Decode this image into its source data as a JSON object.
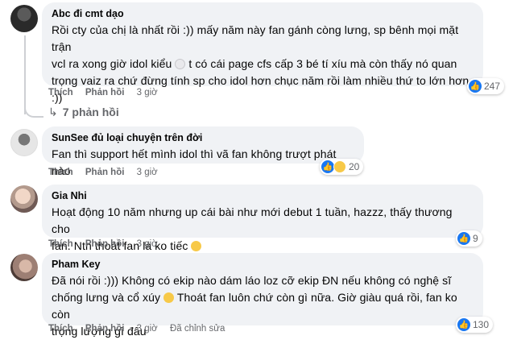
{
  "comments": [
    {
      "author": "Abc đi cmt dạo",
      "lines": [
        "Rồi cty của chị là nhất rồi :)) mấy năm này fan gánh còng lưng, sp bênh mọi mặt trận",
        "vcl ra xong giờ idol kiểu",
        "t có cái page cfs cấp 3 bé tí xíu mà còn thấy nó quan",
        "trọng vaiz ra chứ đừng tính sp cho idol hơn chục năm rồi làm nhiều thứ to lớn hơn",
        ":))"
      ],
      "like_label": "Thích",
      "reply_label": "Phản hồi",
      "time": "3 giờ",
      "reaction_count": "247",
      "replies_label": "7 phản hồi"
    },
    {
      "author": "SunSee đủ loại chuyện trên đời",
      "lines": [
        "Fan thì support hết mình idol thì vã fan không trượt phát nào"
      ],
      "like_label": "Thích",
      "reply_label": "Phản hồi",
      "time": "3 giờ",
      "reaction_count": "20"
    },
    {
      "author": "Gia Nhi",
      "lines": [
        "Hoạt động 10 năm nhưng up cái bài như mới debut 1 tuần, hazzz, thấy thương cho",
        "fan. Ntn thoát fan là ko tiếc"
      ],
      "like_label": "Thích",
      "reply_label": "Phản hồi",
      "time": "3 giờ",
      "reaction_count": "9"
    },
    {
      "author": "Pham Key",
      "lines": [
        "Đã nói rồi :))) Không có ekip nào dám láo loz cỡ ekip ĐN nếu không có nghệ sĩ",
        "chống lưng và cổ xúy",
        "Thoát fan luôn chứ còn gì nữa. Giờ giàu quá rồi, fan ko còn",
        "trọng lượng gì đâu"
      ],
      "like_label": "Thích",
      "reply_label": "Phản hồi",
      "time": "3 giờ",
      "edited_label": "Đã chỉnh sửa",
      "reaction_count": "130"
    }
  ],
  "colors": {
    "bubble": "#f0f2f5",
    "meta": "#65676b",
    "like": "#1877f2"
  },
  "icons": [
    "like-icon",
    "haha-icon",
    "emoji-icon"
  ]
}
